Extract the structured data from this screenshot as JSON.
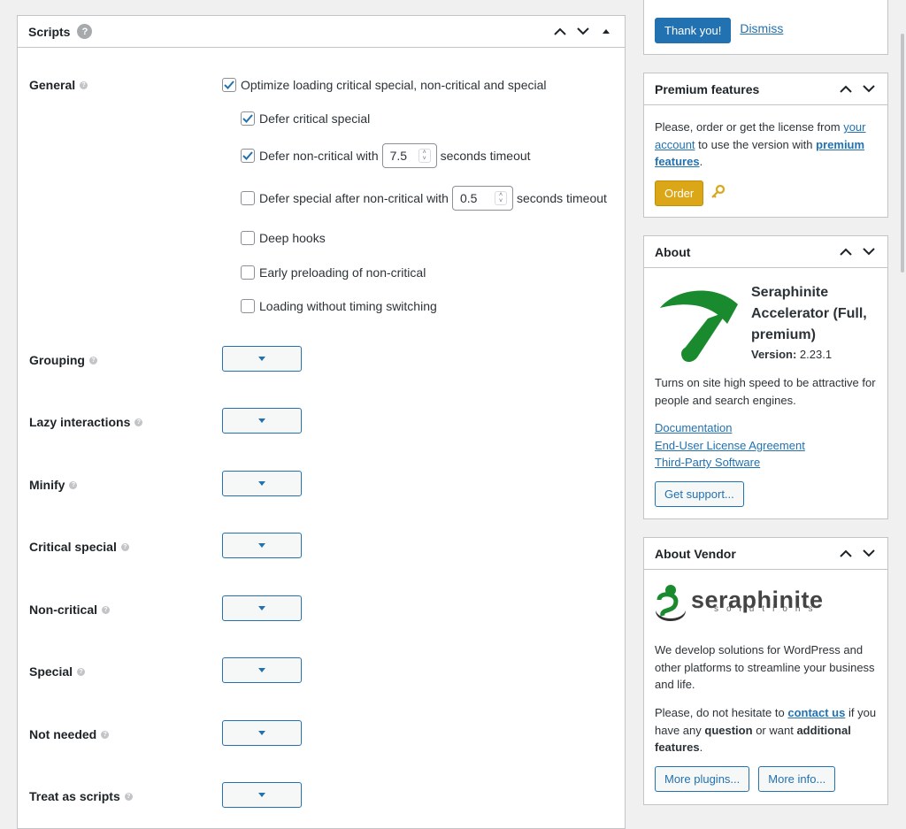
{
  "scripts": {
    "title": "Scripts",
    "help_glyph": "?",
    "general": {
      "label": "General",
      "optimize_label": "Optimize loading critical special, non-critical and special",
      "defer_critical_label": "Defer critical special",
      "defer_noncritical_label": "Defer non-critical with",
      "defer_noncritical_value": "7.5",
      "defer_noncritical_suffix": "seconds timeout",
      "defer_special_label": "Defer special after non-critical with",
      "defer_special_value": "0.5",
      "defer_special_suffix": "seconds timeout",
      "deep_hooks_label": "Deep hooks",
      "early_preloading_label": "Early preloading of non-critical",
      "loading_without_timing_label": "Loading without timing switching"
    },
    "rows": [
      {
        "label": "Grouping"
      },
      {
        "label": "Lazy interactions"
      },
      {
        "label": "Minify"
      },
      {
        "label": "Critical special"
      },
      {
        "label": "Non-critical"
      },
      {
        "label": "Special"
      },
      {
        "label": "Not needed"
      },
      {
        "label": "Treat as scripts"
      }
    ]
  },
  "notice": {
    "thank_you_label": "Thank you!",
    "dismiss_label": "Dismiss"
  },
  "premium": {
    "title": "Premium features",
    "text_before": "Please, order or get the license from",
    "link_your_account": "your account",
    "text_middle": "to use the version with",
    "link_premium_features": "premium features",
    "text_after": ".",
    "order_label": "Order"
  },
  "about": {
    "title": "About",
    "product_name": "Seraphinite Accelerator (Full, premium)",
    "version_label": "Version:",
    "version_value": "2.23.1",
    "description": "Turns on site high speed to be attractive for people and search engines.",
    "link_documentation": "Documentation",
    "link_eula": "End-User License Agreement",
    "link_third_party": "Third-Party Software",
    "support_label": "Get support..."
  },
  "vendor": {
    "title": "About Vendor",
    "logo_word": "seraphinite",
    "logo_sub": "solutions",
    "description": "We develop solutions for WordPress and other platforms to streamline your business and life.",
    "contact_before": "Please, do not hesitate to",
    "contact_link": "contact us",
    "contact_middle": "if you have any",
    "contact_question": "question",
    "contact_or": "or want",
    "contact_additional": "additional features",
    "contact_end": ".",
    "more_plugins_label": "More plugins...",
    "more_info_label": "More info..."
  },
  "colors": {
    "accent": "#2271b1",
    "order": "#dba617",
    "logo_green": "#1a8a2e"
  }
}
